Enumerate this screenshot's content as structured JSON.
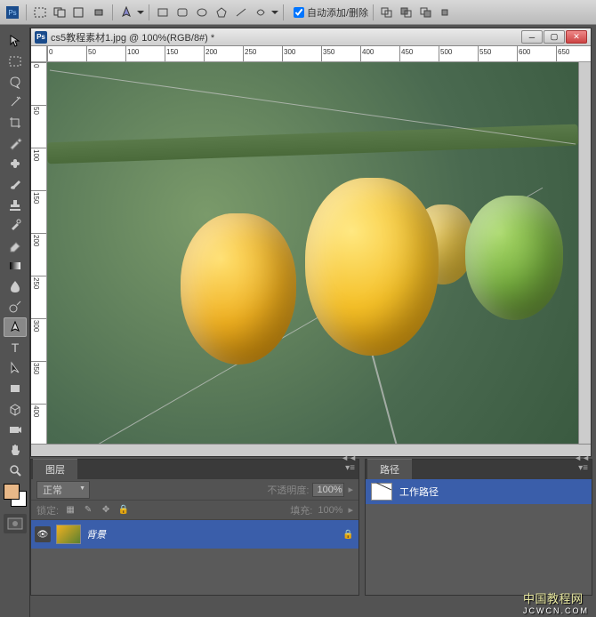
{
  "toolbar": {
    "auto_add_delete_label": "自动添加/删除"
  },
  "document": {
    "title": "cs5教程素材1.jpg @ 100%(RGB/8#) *"
  },
  "ruler_h": [
    "0",
    "50",
    "100",
    "150",
    "200",
    "250",
    "300",
    "350",
    "400",
    "450",
    "500",
    "550",
    "600",
    "650"
  ],
  "ruler_v": [
    "0",
    "50",
    "100",
    "150",
    "200",
    "250",
    "300",
    "350",
    "400"
  ],
  "layers_panel": {
    "tab": "图层",
    "blend_mode": "正常",
    "opacity_label": "不透明度:",
    "opacity_value": "100%",
    "lock_label": "锁定:",
    "fill_label": "填充:",
    "fill_value": "100%",
    "layer_name": "背景"
  },
  "paths_panel": {
    "tab": "路径",
    "path_name": "工作路径"
  },
  "watermark": {
    "line1": "中国教程网",
    "line2": "JCWCN.COM"
  }
}
